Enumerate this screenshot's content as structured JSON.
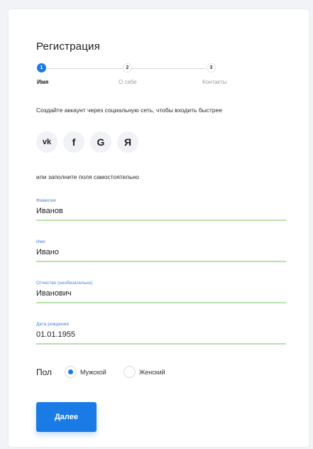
{
  "form": {
    "title": "Регистрация",
    "steps": [
      {
        "number": "1",
        "label": "Имя",
        "active": true
      },
      {
        "number": "2",
        "label": "О себе",
        "active": false
      },
      {
        "number": "3",
        "label": "Контакты",
        "active": false
      }
    ],
    "social_hint": "Создайте аккаунт через социальную сеть, чтобы входить быстрее",
    "social": [
      {
        "glyph": "vk",
        "icon": "vk-icon"
      },
      {
        "glyph": "f",
        "icon": "facebook-icon"
      },
      {
        "glyph": "G",
        "icon": "google-icon"
      },
      {
        "glyph": "Я",
        "icon": "yandex-icon"
      }
    ],
    "or_text": "или заполните поля самостоятельно",
    "fields": {
      "last_name": {
        "label": "Фамилия",
        "value": "Иванов"
      },
      "first_name": {
        "label": "Имя",
        "value": "Ивано"
      },
      "patronymic": {
        "label": "Отчество (необязательно)",
        "value": "Иванович"
      },
      "birth_date": {
        "label": "Дата рождения",
        "value": "01.01.1955"
      }
    },
    "gender": {
      "label": "Пол",
      "options": [
        {
          "label": "Мужской",
          "checked": true
        },
        {
          "label": "Женский",
          "checked": false
        }
      ]
    },
    "submit_label": "Далее"
  },
  "colors": {
    "accent": "#1a7be6",
    "field_underline": "#b6e2a8",
    "field_label": "#4a83d8"
  }
}
